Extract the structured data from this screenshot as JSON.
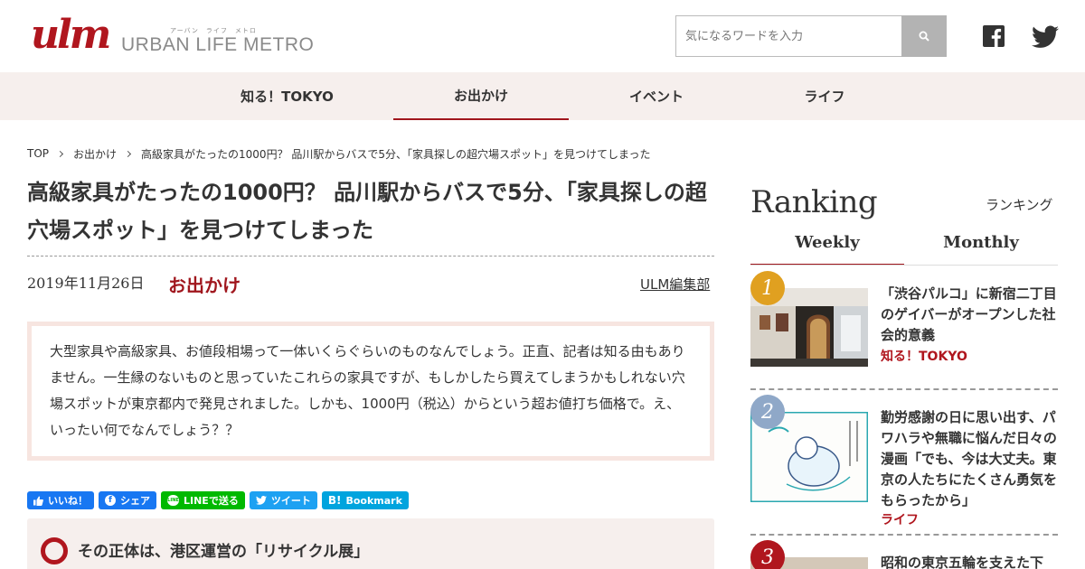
{
  "header": {
    "logo_mark": "ulm",
    "logo_ruby": "アーバン　ライフ　メトロ",
    "logo_text": "URBAN LIFE METRO",
    "search_placeholder": "気になるワードを入力",
    "search_icon": "search-icon",
    "social": [
      "facebook-icon",
      "twitter-icon"
    ]
  },
  "nav": {
    "items": [
      {
        "label": "知る！TOKYO"
      },
      {
        "label": "お出かけ"
      },
      {
        "label": "イベント"
      },
      {
        "label": "ライフ"
      }
    ],
    "active": "お出かけ"
  },
  "breadcrumb": {
    "items": [
      "TOP",
      "お出かけ",
      "高級家具がたったの1000円？ 品川駅からバスで5分、「家具探しの超穴場スポット」を見つけてしまった"
    ]
  },
  "article": {
    "title": "高級家具がたったの1000円？ 品川駅からバスで5分、「家具探しの超穴場スポット」を見つけてしまった",
    "date": "2019年11月26日",
    "category": "お出かけ",
    "author": "ULM編集部",
    "lead": "大型家具や高級家具、お値段相場って一体いくらぐらいのものなんでしょう。正直、記者は知る由もありません。一生縁のないものと思っていたこれらの家具ですが、もしかしたら買えてしまうかもしれない穴場スポットが東京都内で発見されました。しかも、1000円（税込）からという超お値打ち価格で。え、いったい何でなんでしょう？？",
    "share": {
      "like": "いいね！",
      "share": "シェア",
      "line": "LINEで送る",
      "tweet": "ツイート",
      "bookmark": "Bookmark"
    },
    "section_heading": "その正体は、港区運営の「リサイクル展」"
  },
  "ranking": {
    "title": "Ranking",
    "subtitle": "ランキング",
    "tabs": [
      {
        "label": "Weekly"
      },
      {
        "label": "Monthly"
      }
    ],
    "active_tab": "Weekly",
    "items": [
      {
        "rank": "1",
        "title": "「渋谷パルコ」に新宿二丁目のゲイバーがオープンした社会的意義",
        "category": "知る！TOKYO",
        "badge_color": "#e0a020"
      },
      {
        "rank": "2",
        "title": "勤労感謝の日に思い出す、パワハラや無職に悩んだ日々の漫画「でも、今は大丈夫。東京の人たちにたくさん勇気をもらったから」",
        "category": "ライフ",
        "badge_color": "#8fa8c8"
      },
      {
        "rank": "3",
        "title": "昭和の東京五輪を支えた下",
        "category": "",
        "badge_color": "#b0161e"
      }
    ]
  },
  "colors": {
    "accent": "#a0161d",
    "nav_bg": "#f6efed",
    "lead_border": "#f7e5e0"
  }
}
